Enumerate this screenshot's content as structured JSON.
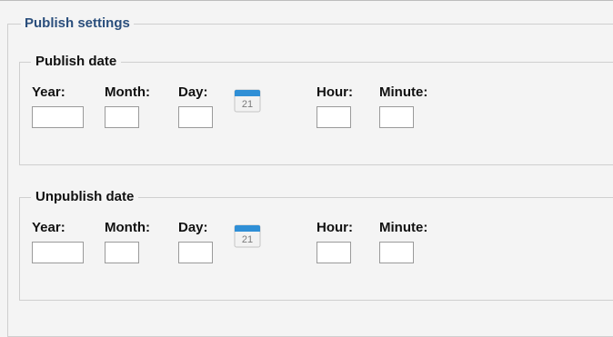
{
  "settings_title": "Publish settings",
  "publish": {
    "title": "Publish date",
    "labels": {
      "year": "Year:",
      "month": "Month:",
      "day": "Day:",
      "hour": "Hour:",
      "minute": "Minute:"
    },
    "calendar_day": "21"
  },
  "unpublish": {
    "title": "Unpublish date",
    "labels": {
      "year": "Year:",
      "month": "Month:",
      "day": "Day:",
      "hour": "Hour:",
      "minute": "Minute:"
    },
    "calendar_day": "21"
  },
  "icons": {
    "calendar": "calendar-icon"
  },
  "colors": {
    "legend_title": "#2a4e7c",
    "calendar_header": "#2f8fd6"
  }
}
